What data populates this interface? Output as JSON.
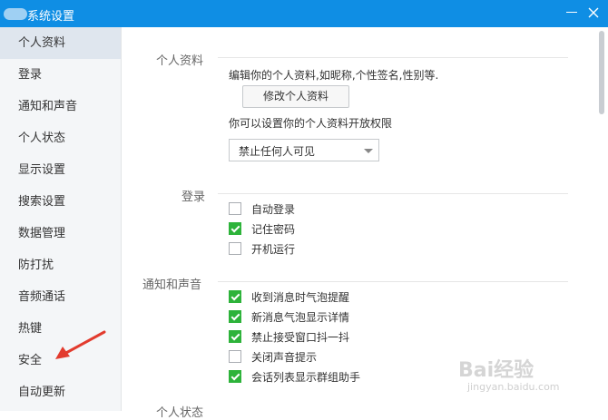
{
  "window": {
    "title": "系统设置"
  },
  "sidebar": {
    "items": [
      {
        "label": "个人资料",
        "active": true
      },
      {
        "label": "登录"
      },
      {
        "label": "通知和声音"
      },
      {
        "label": "个人状态"
      },
      {
        "label": "显示设置"
      },
      {
        "label": "搜索设置"
      },
      {
        "label": "数据管理"
      },
      {
        "label": "防打扰"
      },
      {
        "label": "音频通话"
      },
      {
        "label": "热键"
      },
      {
        "label": "安全"
      },
      {
        "label": "自动更新"
      }
    ]
  },
  "profile": {
    "label": "个人资料",
    "description": "编辑你的个人资料,如昵称,个性签名,性别等.",
    "edit_button": "修改个人资料",
    "permission_text": "你可以设置你的个人资料开放权限",
    "permission_select": "禁止任何人可见"
  },
  "login": {
    "label": "登录",
    "options": [
      {
        "label": "自动登录",
        "checked": false
      },
      {
        "label": "记住密码",
        "checked": true
      },
      {
        "label": "开机运行",
        "checked": false
      }
    ]
  },
  "notify": {
    "label": "通知和声音",
    "options": [
      {
        "label": "收到消息时气泡提醒",
        "checked": true
      },
      {
        "label": "新消息气泡显示详情",
        "checked": true
      },
      {
        "label": "禁止接受窗口抖一抖",
        "checked": true
      },
      {
        "label": "关闭声音提示",
        "checked": false
      },
      {
        "label": "会话列表显示群组助手",
        "checked": true
      }
    ]
  },
  "status_section": {
    "label": "个人状态"
  },
  "colors": {
    "titlebar": "#0f8ee4",
    "checkbox_checked": "#2db33a",
    "arrow": "#e23b2e"
  },
  "watermark": {
    "text": "Bai经验",
    "sub": "jingyan.baidu.com"
  }
}
